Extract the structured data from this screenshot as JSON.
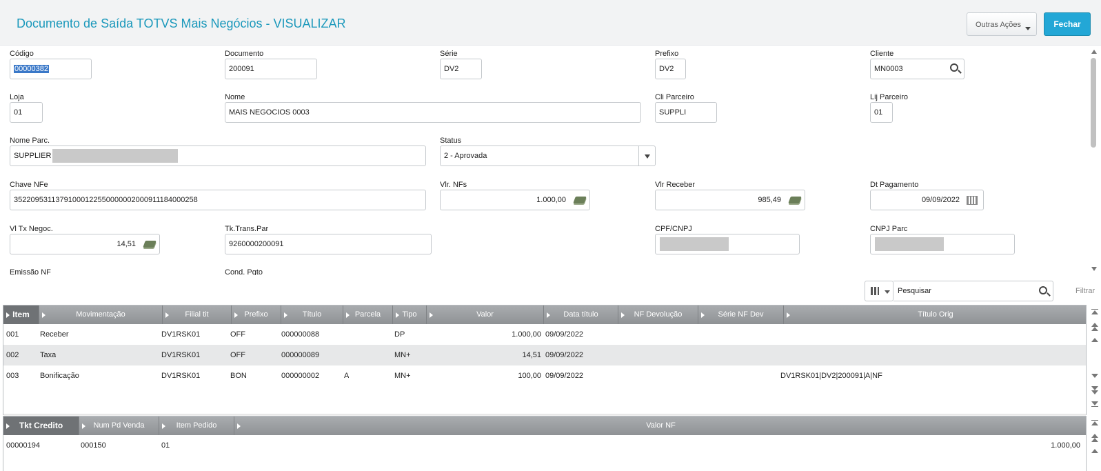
{
  "header": {
    "title": "Documento de Saída TOTVS Mais Negócios - VISUALIZAR",
    "outras_acoes": "Outras Ações",
    "fechar": "Fechar"
  },
  "form": {
    "codigo": {
      "label": "Código",
      "value": "00000382"
    },
    "documento": {
      "label": "Documento",
      "value": "200091"
    },
    "serie": {
      "label": "Série",
      "value": "DV2"
    },
    "prefixo": {
      "label": "Prefixo",
      "value": "DV2"
    },
    "cliente": {
      "label": "Cliente",
      "value": "MN0003"
    },
    "loja": {
      "label": "Loja",
      "value": "01"
    },
    "nome": {
      "label": "Nome",
      "value": "MAIS NEGOCIOS 0003"
    },
    "cli_parceiro": {
      "label": "Cli Parceiro",
      "value": "SUPPLI"
    },
    "lj_parceiro": {
      "label": "Lij Parceiro",
      "value": "01"
    },
    "nome_parc": {
      "label": "Nome Parc.",
      "value": "SUPPLIER"
    },
    "status": {
      "label": "Status",
      "value": "2 - Aprovada"
    },
    "chave_nfe": {
      "label": "Chave NFe",
      "value": "35220953113791000122550000002000911184000258"
    },
    "vlr_nfs": {
      "label": "Vlr. NFs",
      "value": "1.000,00"
    },
    "vlr_receber": {
      "label": "Vlr Receber",
      "value": "985,49"
    },
    "dt_pagamento": {
      "label": "Dt Pagamento",
      "value": "09/09/2022"
    },
    "vl_tx_negoc": {
      "label": "Vl Tx Negoc.",
      "value": "14,51"
    },
    "tk_trans_par": {
      "label": "Tk.Trans.Par",
      "value": "9260000200091"
    },
    "cpf_cnpj": {
      "label": "CPF/CNPJ",
      "value": ""
    },
    "cnpj_parc": {
      "label": "CNPJ Parc",
      "value": ""
    },
    "emissao_nf": {
      "label": "Emissão NF"
    },
    "cond_pgto": {
      "label": "Cond. Pgto"
    }
  },
  "search": {
    "placeholder": "Pesquisar",
    "filtrar": "Filtrar"
  },
  "grid1": {
    "columns": [
      "Item",
      "Movimentação",
      "Filial tit",
      "Prefixo",
      "Título",
      "Parcela",
      "Tipo",
      "Valor",
      "Data título",
      "NF Devolução",
      "Série NF Dev",
      "Título Orig"
    ],
    "rows": [
      [
        "001",
        "Receber",
        "DV1RSK01",
        "OFF",
        "000000088",
        "",
        "DP",
        "1.000,00",
        "09/09/2022",
        "",
        "",
        ""
      ],
      [
        "002",
        "Taxa",
        "DV1RSK01",
        "OFF",
        "000000089",
        "",
        "MN+",
        "14,51",
        "09/09/2022",
        "",
        "",
        ""
      ],
      [
        "003",
        "Bonificação",
        "DV1RSK01",
        "BON",
        "000000002",
        "A",
        "MN+",
        "100,00",
        "09/09/2022",
        "",
        "",
        "DV1RSK01|DV2|200091|A|NF"
      ]
    ]
  },
  "grid2": {
    "columns": [
      "Tkt Credito",
      "Num Pd Venda",
      "Item Pedido",
      "Valor NF"
    ],
    "rows": [
      [
        "00000194",
        "000150",
        "01",
        "1.000,00"
      ]
    ]
  }
}
